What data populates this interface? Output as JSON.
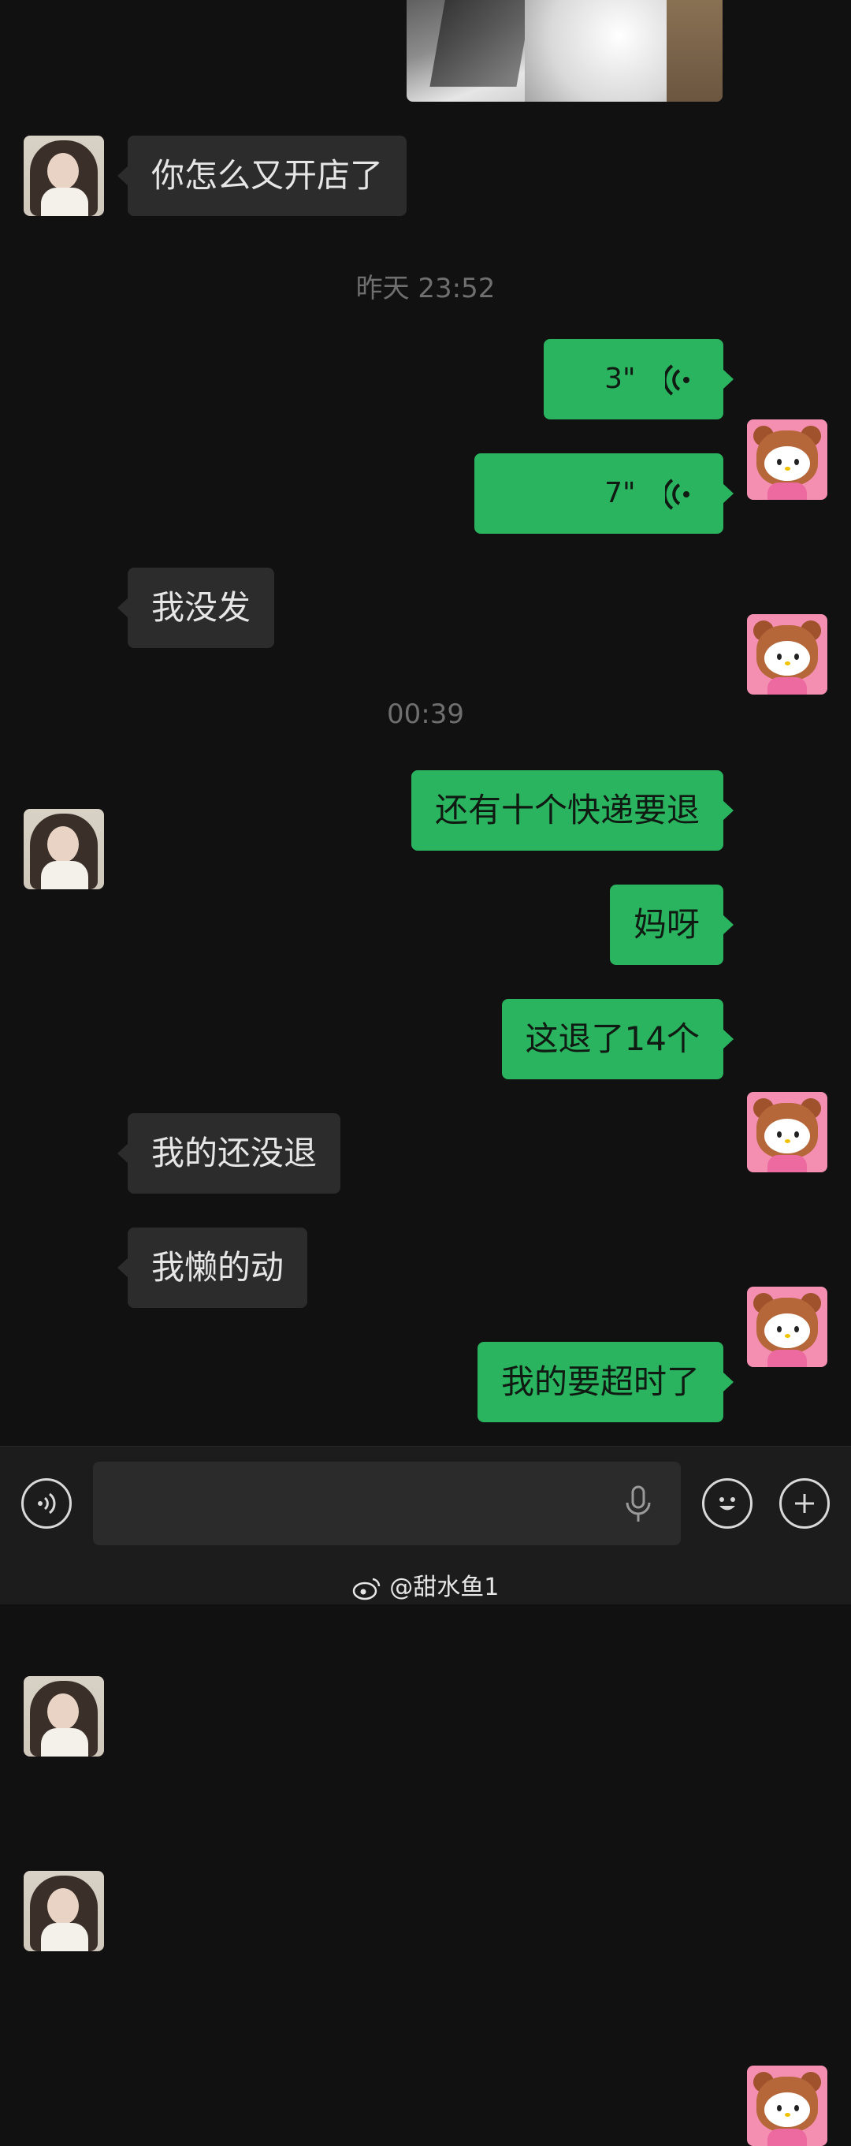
{
  "chat": {
    "photo_icon": "shared-photo",
    "messages": [
      {
        "side": "in",
        "text": "你怎么又开店了"
      },
      {
        "type": "timestamp",
        "text": "昨天 23:52"
      },
      {
        "side": "out",
        "type": "voice",
        "duration": "3\""
      },
      {
        "side": "out",
        "type": "voice",
        "duration": "7\""
      },
      {
        "side": "in",
        "text": "我没发"
      },
      {
        "type": "timestamp",
        "text": "00:39"
      },
      {
        "side": "out",
        "text": "还有十个快递要退"
      },
      {
        "side": "out",
        "text": "妈呀"
      },
      {
        "side": "out",
        "text": "这退了14个"
      },
      {
        "side": "in",
        "text": "我的还没退"
      },
      {
        "side": "in",
        "text": "我懒的动"
      },
      {
        "side": "out",
        "text": "我的要超时了"
      }
    ]
  },
  "input_bar": {
    "left_icon": "voice-mode-icon",
    "mic_icon": "microphone-icon",
    "emoji_icon": "emoji-icon",
    "plus_icon": "plus-icon"
  },
  "watermark": {
    "text": "@甜水鱼1",
    "icon": "weibo-icon"
  },
  "colors": {
    "background": "#111111",
    "outgoing": "#2ab45f",
    "incoming": "#2c2c2c",
    "timestamp": "#6f6f6f"
  }
}
